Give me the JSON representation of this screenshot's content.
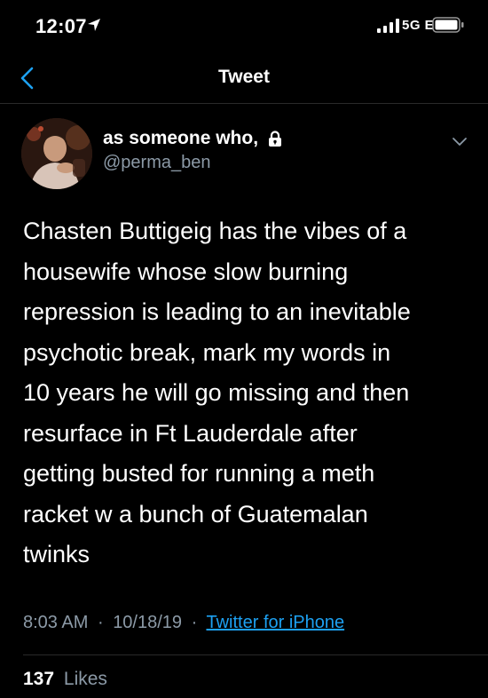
{
  "status_bar": {
    "time": "12:07",
    "location_icon": "location-arrow-icon",
    "signal_icon": "cellular-signal-icon",
    "network": "5G E",
    "battery_icon": "battery-icon"
  },
  "nav": {
    "back_icon": "chevron-left-icon",
    "title": "Tweet"
  },
  "tweet": {
    "author": {
      "display_name": "as someone who,",
      "protected_icon": "lock-icon",
      "handle": "@perma_ben"
    },
    "menu_icon": "chevron-down-icon",
    "text_lines": [
      "Chasten Buttigeig has the vibes of a",
      "housewife whose slow burning",
      "repression is leading to an inevitable",
      "psychotic break, mark my words in",
      "10 years he will go missing and then",
      "resurface in Ft Lauderdale after",
      "getting busted for running a meth",
      "racket w a bunch of Guatemalan",
      "twinks"
    ],
    "time": "8:03 AM",
    "date": "10/18/19",
    "separator": "·",
    "source": "Twitter for iPhone",
    "likes_count": "137",
    "likes_label": "Likes"
  },
  "colors": {
    "background": "#000000",
    "primary_text": "#ffffff",
    "secondary_text": "#8c9aa7",
    "link": "#1da1f2",
    "divider": "#2a2a2a"
  }
}
